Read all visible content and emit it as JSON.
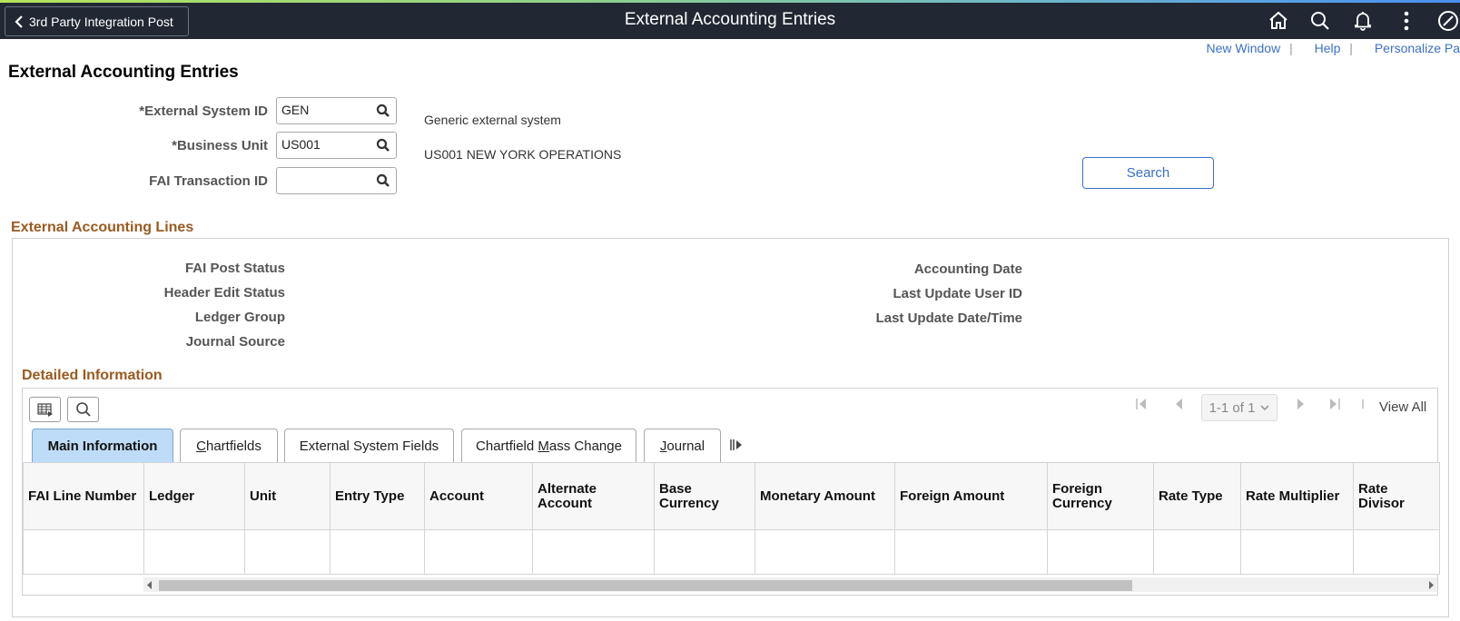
{
  "header": {
    "back_label": "3rd Party Integration Post",
    "title": "External Accounting Entries",
    "icons": [
      "home-icon",
      "search-icon",
      "notification-bell-icon",
      "actions-menu-icon",
      "navbar-compass-icon"
    ]
  },
  "links": {
    "new_window": "New Window",
    "help": "Help",
    "personalize": "Personalize Pa",
    "separator": "|"
  },
  "page_title": "External Accounting Entries",
  "search_form": {
    "external_system_id": {
      "label": "*External System ID",
      "value": "GEN",
      "description": "Generic external system"
    },
    "business_unit": {
      "label": "*Business Unit",
      "value": "US001",
      "description": "US001 NEW YORK OPERATIONS"
    },
    "fai_transaction_id": {
      "label": "FAI Transaction ID",
      "value": ""
    },
    "search_button": "Search"
  },
  "lines_section": {
    "title": "External Accounting Lines",
    "left_fields": [
      "FAI Post Status",
      "Header Edit Status",
      "Ledger Group",
      "Journal Source"
    ],
    "right_fields": [
      "Accounting Date",
      "Last Update User ID",
      "Last Update Date/Time"
    ]
  },
  "detail_section": {
    "title": "Detailed Information",
    "pager": {
      "range": "1-1 of 1",
      "view_all": "View All"
    },
    "tabs": [
      {
        "label": "Main Information",
        "active": true,
        "accesskey": ""
      },
      {
        "pre": "",
        "key": "C",
        "post": "hartfields"
      },
      {
        "label": "External System Fields"
      },
      {
        "pre": "Chartfield ",
        "key": "M",
        "post": "ass Change"
      },
      {
        "pre": "",
        "key": "J",
        "post": "ournal"
      }
    ],
    "columns": [
      "FAI Line Number",
      "Ledger",
      "Unit",
      "Entry Type",
      "Account",
      "Alternate Account",
      "Base Currency",
      "Monetary Amount",
      "Foreign Amount",
      "Foreign Currency",
      "Rate Type",
      "Rate Multiplier",
      "Rate Divisor"
    ],
    "rows": [
      [
        "",
        "",
        "",
        "",
        "",
        "",
        "",
        "",
        "",
        "",
        "",
        "",
        ""
      ]
    ]
  }
}
